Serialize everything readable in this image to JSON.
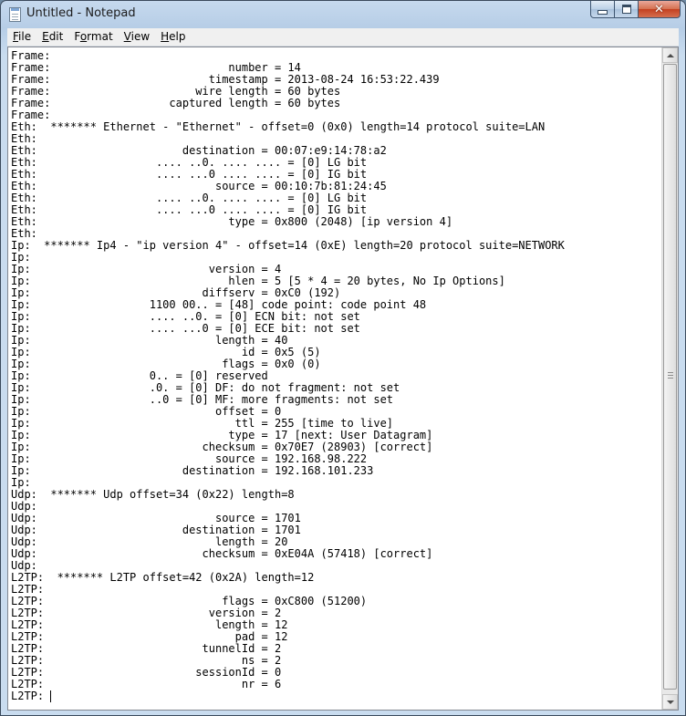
{
  "window": {
    "title": "Untitled - Notepad",
    "close_glyph": "✕"
  },
  "menu": {
    "items": [
      {
        "underline": "F",
        "rest": "ile"
      },
      {
        "underline": "E",
        "rest": "dit"
      },
      {
        "underline": "",
        "prefix": "F",
        "underline2": "o",
        "rest": "rmat"
      },
      {
        "underline": "V",
        "rest": "iew"
      },
      {
        "underline": "H",
        "rest": "elp"
      }
    ],
    "file_u": "F",
    "file_rest": "ile",
    "edit_u": "E",
    "edit_rest": "dit",
    "format_pre": "F",
    "format_u": "o",
    "format_rest": "rmat",
    "view_u": "V",
    "view_rest": "iew",
    "help_u": "H",
    "help_rest": "elp"
  },
  "editor": {
    "lines": [
      "Frame:",
      "Frame:                           number = 14",
      "Frame:                        timestamp = 2013-08-24 16:53:22.439",
      "Frame:                      wire length = 60 bytes",
      "Frame:                  captured length = 60 bytes",
      "Frame:",
      "Eth:  ******* Ethernet - \"Ethernet\" - offset=0 (0x0) length=14 protocol suite=LAN",
      "Eth:",
      "Eth:                      destination = 00:07:e9:14:78:a2",
      "Eth:                  .... ..0. .... .... = [0] LG bit",
      "Eth:                  .... ...0 .... .... = [0] IG bit",
      "Eth:                           source = 00:10:7b:81:24:45",
      "Eth:                  .... ..0. .... .... = [0] LG bit",
      "Eth:                  .... ...0 .... .... = [0] IG bit",
      "Eth:                             type = 0x800 (2048) [ip version 4]",
      "Eth:",
      "Ip:  ******* Ip4 - \"ip version 4\" - offset=14 (0xE) length=20 protocol suite=NETWORK",
      "Ip:",
      "Ip:                           version = 4",
      "Ip:                              hlen = 5 [5 * 4 = 20 bytes, No Ip Options]",
      "Ip:                          diffserv = 0xC0 (192)",
      "Ip:                  1100 00.. = [48] code point: code point 48",
      "Ip:                  .... ..0. = [0] ECN bit: not set",
      "Ip:                  .... ...0 = [0] ECE bit: not set",
      "Ip:                            length = 40",
      "Ip:                                id = 0x5 (5)",
      "Ip:                             flags = 0x0 (0)",
      "Ip:                  0.. = [0] reserved",
      "Ip:                  .0. = [0] DF: do not fragment: not set",
      "Ip:                  ..0 = [0] MF: more fragments: not set",
      "Ip:                            offset = 0",
      "Ip:                               ttl = 255 [time to live]",
      "Ip:                              type = 17 [next: User Datagram]",
      "Ip:                          checksum = 0x70E7 (28903) [correct]",
      "Ip:                            source = 192.168.98.222",
      "Ip:                       destination = 192.168.101.233",
      "Ip:",
      "Udp:  ******* Udp offset=34 (0x22) length=8",
      "Udp:",
      "Udp:                           source = 1701",
      "Udp:                      destination = 1701",
      "Udp:                           length = 20",
      "Udp:                         checksum = 0xE04A (57418) [correct]",
      "Udp:",
      "L2TP:  ******* L2TP offset=42 (0x2A) length=12",
      "L2TP:",
      "L2TP:                           flags = 0xC800 (51200)",
      "L2TP:                         version = 2",
      "L2TP:                          length = 12",
      "L2TP:                             pad = 12",
      "L2TP:                        tunnelId = 2",
      "L2TP:                              ns = 2",
      "L2TP:                       sessionId = 0",
      "L2TP:                              nr = 6",
      "L2TP: "
    ]
  }
}
